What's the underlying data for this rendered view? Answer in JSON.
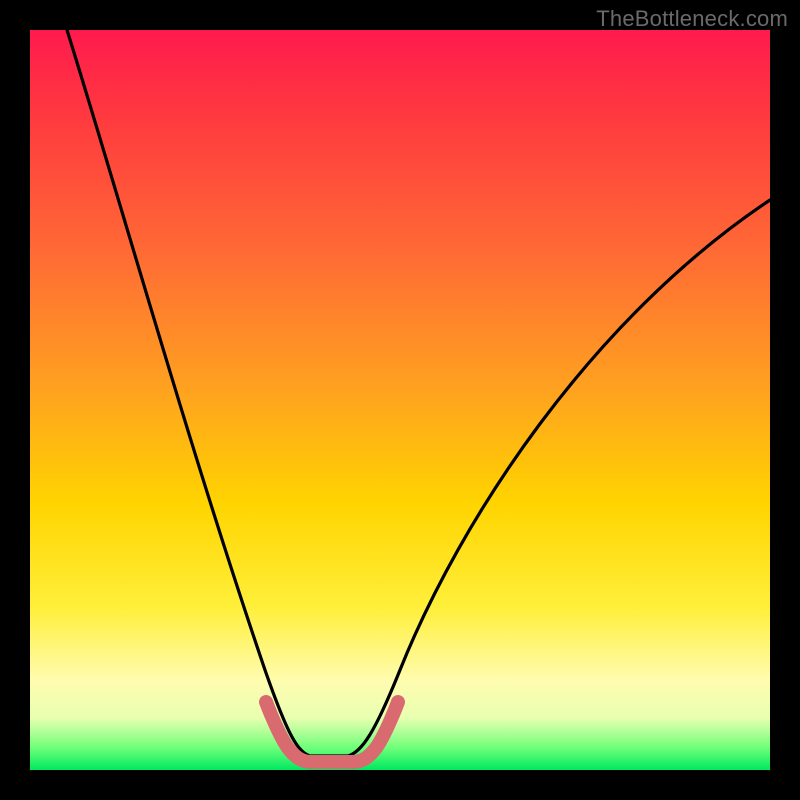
{
  "watermark": {
    "text": "TheBottleneck.com"
  },
  "chart_data": {
    "type": "line",
    "title": "",
    "xlabel": "",
    "ylabel": "",
    "xlim": [
      0,
      100
    ],
    "ylim": [
      0,
      100
    ],
    "grid": false,
    "legend": false,
    "series": [
      {
        "name": "bottleneck-curve",
        "x": [
          5,
          10,
          15,
          20,
          25,
          30,
          33,
          35,
          37,
          40,
          43,
          45,
          50,
          55,
          60,
          65,
          70,
          75,
          80,
          85,
          90,
          95,
          100
        ],
        "y": [
          100,
          84,
          68,
          52,
          36,
          20,
          8,
          3,
          2,
          2,
          3,
          6,
          14,
          23,
          32,
          40,
          47,
          53,
          58,
          63,
          67,
          70,
          73
        ]
      }
    ],
    "annotations": [
      {
        "name": "optimal-bracket",
        "shape": "bracket",
        "x_range": [
          33,
          45
        ],
        "y": 3,
        "color": "#d96a6f"
      }
    ],
    "background_gradient": {
      "top": "#ff1a4d",
      "upper_mid": "#ffa020",
      "mid": "#ffef3a",
      "lower_mid": "#fffcb0",
      "bottom": "#00e860"
    }
  }
}
